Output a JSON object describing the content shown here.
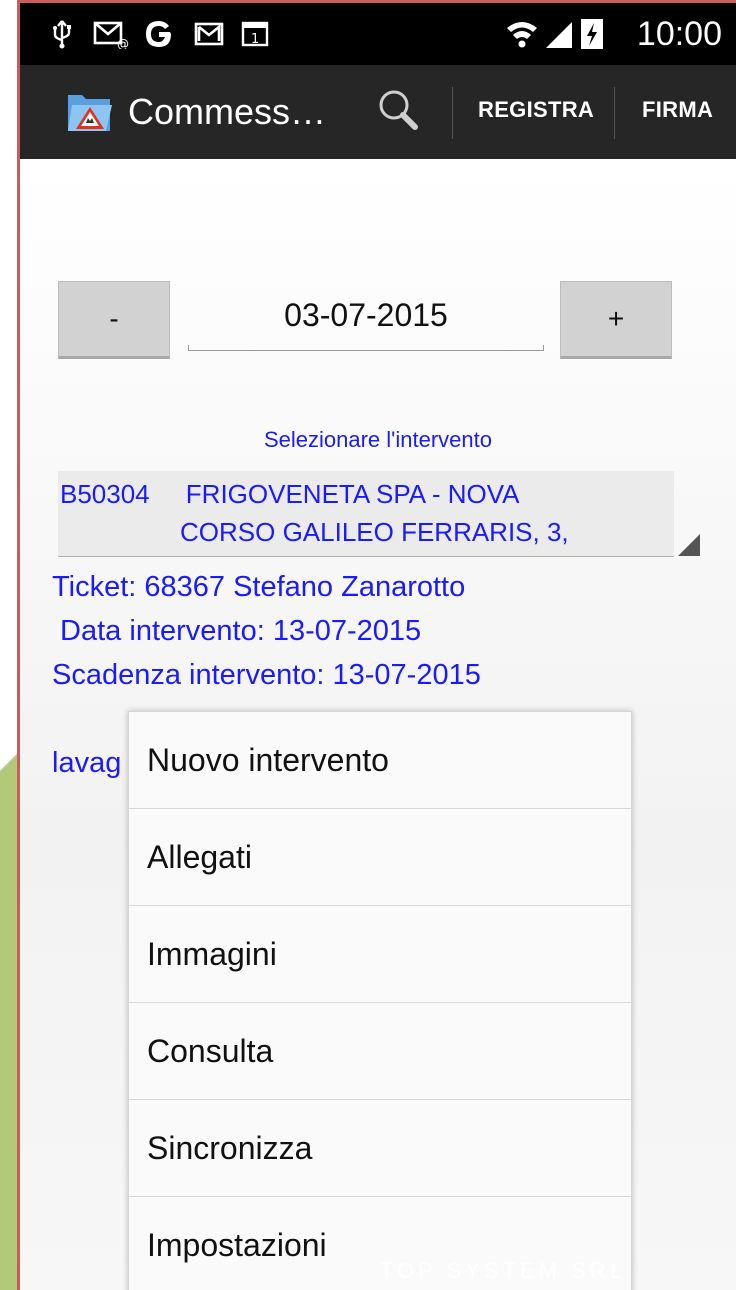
{
  "status_bar": {
    "time": "10:00"
  },
  "action_bar": {
    "title": "Commess…",
    "register_label": "REGISTRA",
    "sign_label": "FIRMA"
  },
  "date_picker": {
    "minus_label": "-",
    "value": "03-07-2015",
    "plus_label": "+"
  },
  "intervention": {
    "prompt": "Selezionare l'intervento",
    "code": "B50304",
    "company": "FRIGOVENETA SPA - NOVA",
    "address": "CORSO GALILEO FERRARIS, 3,"
  },
  "details": {
    "ticket": "Ticket: 68367 Stefano Zanarotto",
    "date": " Data intervento: 13-07-2015",
    "deadline": "Scadenza intervento: 13-07-2015",
    "partial": "lavag"
  },
  "menu": {
    "items": [
      {
        "label": "Nuovo intervento"
      },
      {
        "label": "Allegati"
      },
      {
        "label": "Immagini"
      },
      {
        "label": "Consulta"
      },
      {
        "label": "Sincronizza"
      },
      {
        "label": "Impostazioni"
      }
    ]
  },
  "watermark": "TOP SYSTEM SRL",
  "colors": {
    "accent_text": "#1a1aff",
    "action_bar": "#262626",
    "frame_green": "#b3c97a",
    "frame_red": "#c95c5c"
  }
}
